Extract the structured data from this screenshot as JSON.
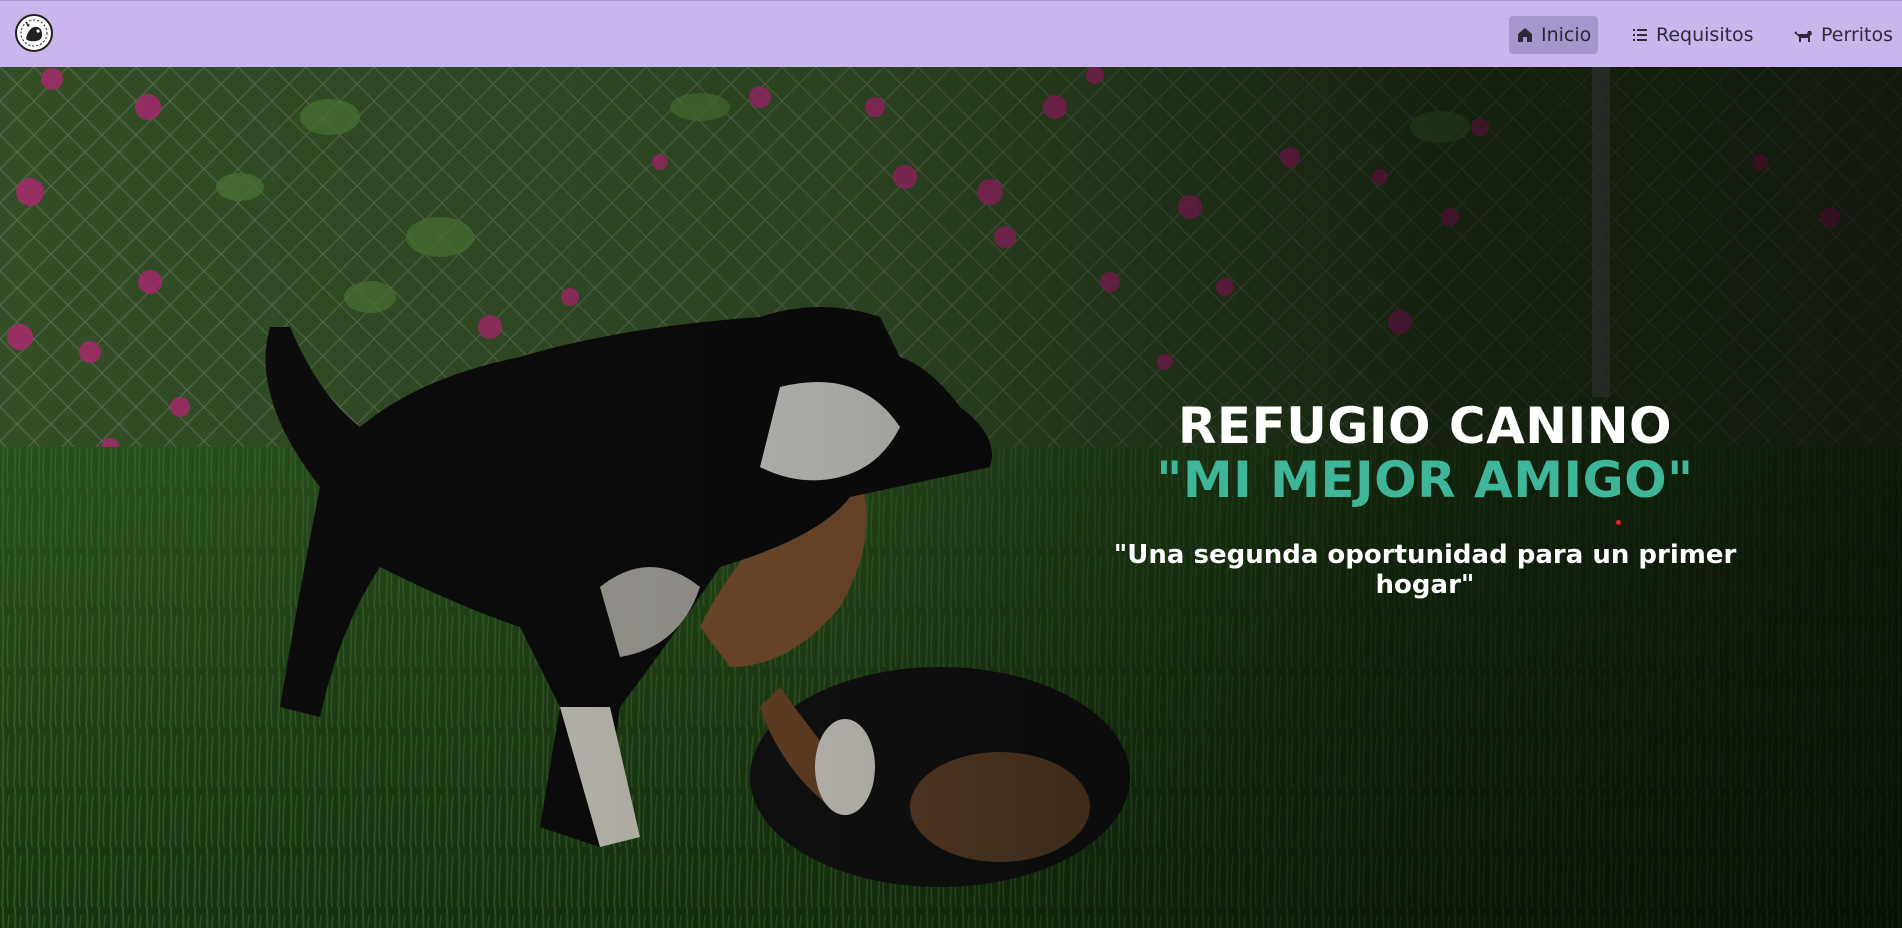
{
  "navbar": {
    "logo_icon": "shelter-logo-icon",
    "items": [
      {
        "label": "Inicio",
        "icon": "home-icon",
        "active": true
      },
      {
        "label": "Requisitos",
        "icon": "list-icon",
        "active": false
      },
      {
        "label": "Perritos",
        "icon": "dog-icon",
        "active": false
      }
    ]
  },
  "hero": {
    "title_line1": "REFUGIO CANINO",
    "title_line2": "\"MI MEJOR AMIGO\"",
    "slogan": "\"Una segunda oportunidad para un primer hogar\"",
    "background_image": "puppies-playing-in-grass"
  },
  "colors": {
    "navbar_bg": "#c8b6ed",
    "active_tab_bg": "#a597cc",
    "accent_teal": "#3fb59a",
    "title_white": "#ffffff"
  }
}
